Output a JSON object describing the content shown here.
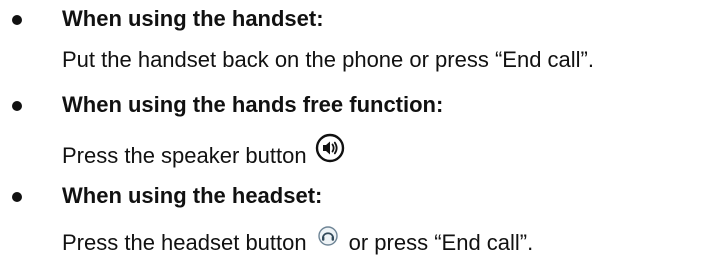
{
  "instructions": [
    {
      "heading": "When using the handset:",
      "body": "Put the handset back on the phone or press “End call”."
    },
    {
      "heading": "When using the hands free function:",
      "body_before_icon": "Press the speaker button",
      "icon": "speaker-icon"
    },
    {
      "heading": "When using the headset:",
      "body_before_icon": "Press the headset button",
      "icon": "headset-icon",
      "body_after_icon": "or press “End call”."
    }
  ]
}
